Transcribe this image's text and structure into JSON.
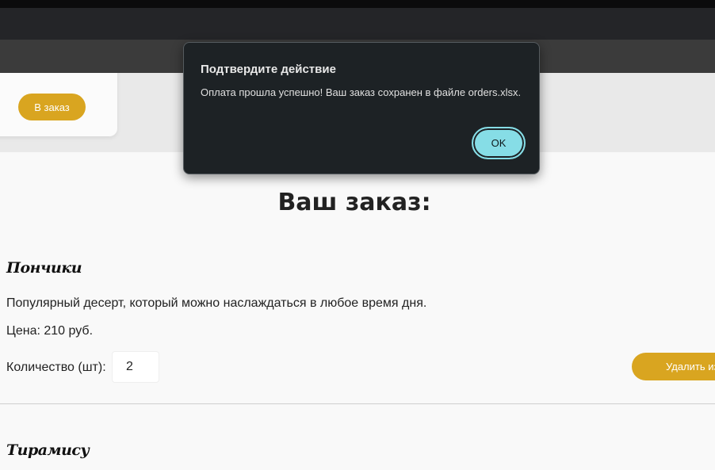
{
  "product_card": {
    "add_button_label": "В заказ"
  },
  "order": {
    "title": "Ваш заказ:",
    "items": [
      {
        "name": "Пончики",
        "description": "Популярный десерт, который можно наслаждаться в любое время дня.",
        "price": "Цена: 210 руб.",
        "quantity_label": "Количество (шт):",
        "quantity": "2",
        "delete_label": "Удалить из заказа"
      },
      {
        "name": "Тирамису"
      }
    ]
  },
  "dialog": {
    "title": "Подтвердите действие",
    "message": "Оплата прошла успешно! Ваш заказ сохранен в файле orders.xlsx.",
    "ok_label": "OK"
  },
  "colors": {
    "accent": "#d9a520",
    "dialog_bg": "#1d2225",
    "ok_button": "#86dde6"
  }
}
